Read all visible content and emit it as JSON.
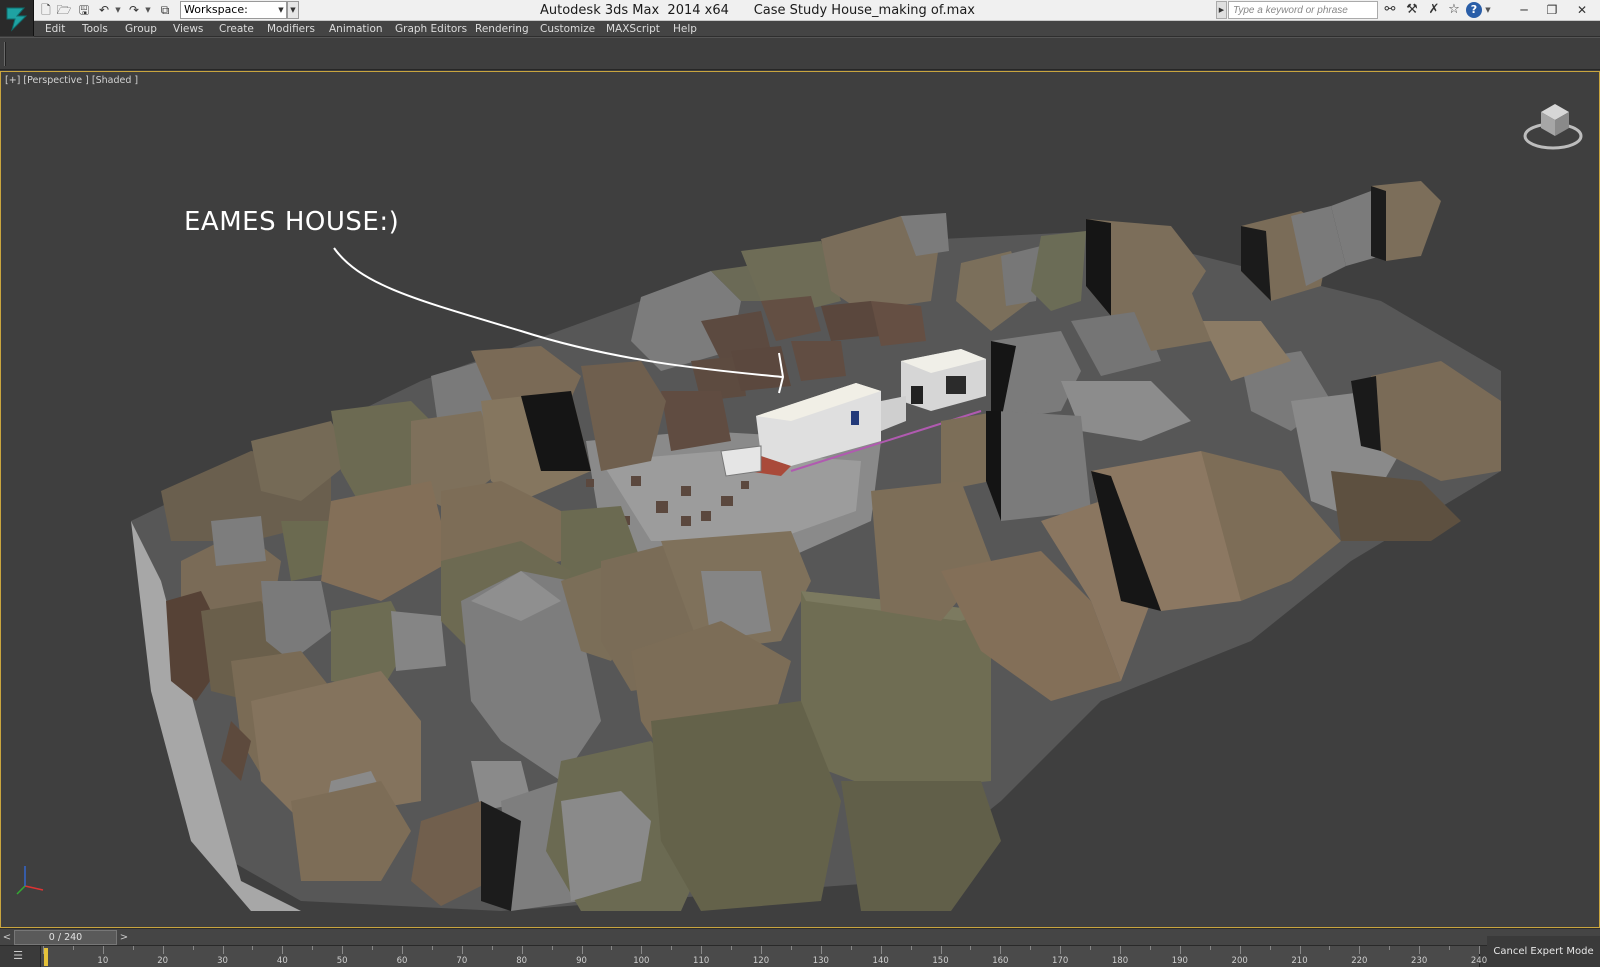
{
  "window": {
    "app_name": "Autodesk 3ds Max  2014 x64",
    "file_name": "Case Study House_making of.max"
  },
  "workspace": {
    "label": "Workspace: Default"
  },
  "search": {
    "placeholder": "Type a keyword or phrase"
  },
  "menu": [
    "Edit",
    "Tools",
    "Group",
    "Views",
    "Create",
    "Modifiers",
    "Animation",
    "Graph Editors",
    "Rendering",
    "Customize",
    "MAXScript",
    "Help"
  ],
  "viewport": {
    "label": "[+] [Perspective ] [Shaded ]",
    "annotation": "EAMES HOUSE:)"
  },
  "timeslider": {
    "position": "0 / 240",
    "prev": "<",
    "next": ">"
  },
  "timeline": {
    "start": 0,
    "end": 240,
    "labels": [
      "10",
      "20",
      "30",
      "40",
      "50",
      "60",
      "70",
      "80",
      "90",
      "100",
      "110",
      "120",
      "130",
      "140",
      "150",
      "160",
      "170",
      "180",
      "190",
      "200",
      "210",
      "220",
      "230",
      "240"
    ]
  },
  "status": {
    "expert_mode": "Cancel Expert Mode"
  },
  "icons": {
    "app_logo": "3dsmax-logo-icon",
    "new": "new-file-icon",
    "open": "open-file-icon",
    "save": "save-icon",
    "undo": "undo-icon",
    "redo": "redo-icon",
    "project": "project-folder-icon",
    "infocenter": [
      "binoculars-icon",
      "tools-icon",
      "x-icon",
      "star-icon",
      "help-icon"
    ],
    "help_glyph": "?",
    "minimize": "─",
    "maximize": "❐",
    "close": "✕"
  },
  "colors": {
    "viewport_border": "#c9a53e",
    "background": "#3f3f3f"
  }
}
